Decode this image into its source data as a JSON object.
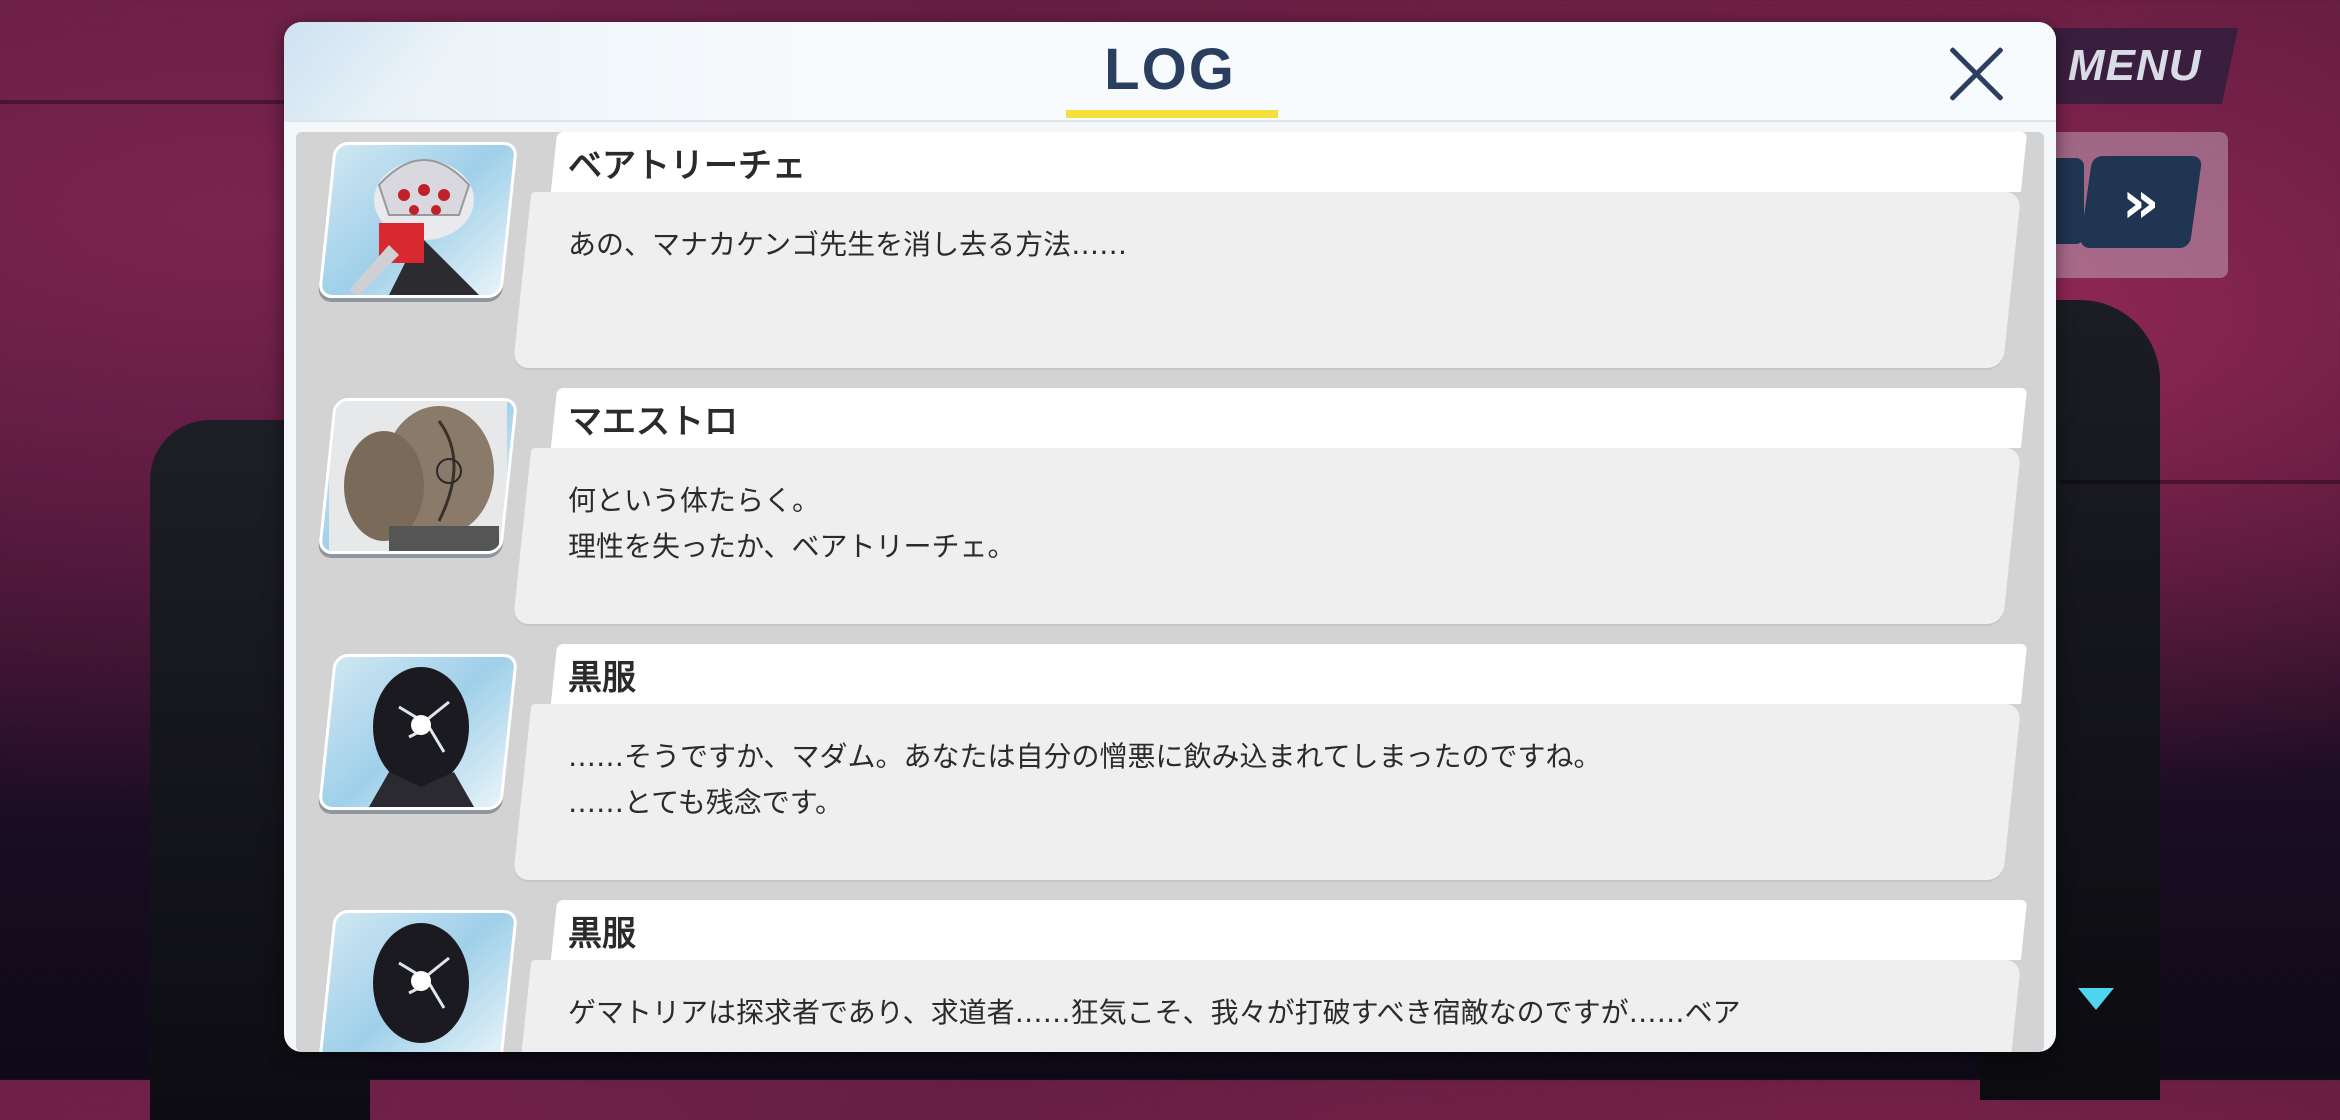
{
  "window": {
    "title": "LOG"
  },
  "controls": {
    "menu_label": "MENU",
    "skip_glyph": "»"
  },
  "colors": {
    "title": "#2a3f5f",
    "underline": "#f5e03a",
    "button": "#1f3552",
    "scroll_indicator": "#4fd4f0"
  },
  "icons": {
    "close": "close-icon",
    "skip": "fast-forward-icon",
    "scroll": "scroll-down-arrow-icon"
  },
  "entries": [
    {
      "name": "ベアトリーチェ",
      "text": "あの、マナカケンゴ先生を消し去る方法……",
      "portrait": "beatrice-portrait"
    },
    {
      "name": "マエストロ",
      "text": "何という体たらく。\n理性を失ったか、ベアトリーチェ。",
      "portrait": "maestro-portrait"
    },
    {
      "name": "黒服",
      "text": "……そうですか、マダム。あなたは自分の憎悪に飲み込まれてしまったのですね。\n……とても残念です。",
      "portrait": "kurofuku-portrait"
    },
    {
      "name": "黒服",
      "text": "ゲマトリアは探求者であり、求道者……狂気こそ、我々が打破すべき宿敵なのですが……ベア",
      "portrait": "kurofuku-portrait"
    }
  ]
}
